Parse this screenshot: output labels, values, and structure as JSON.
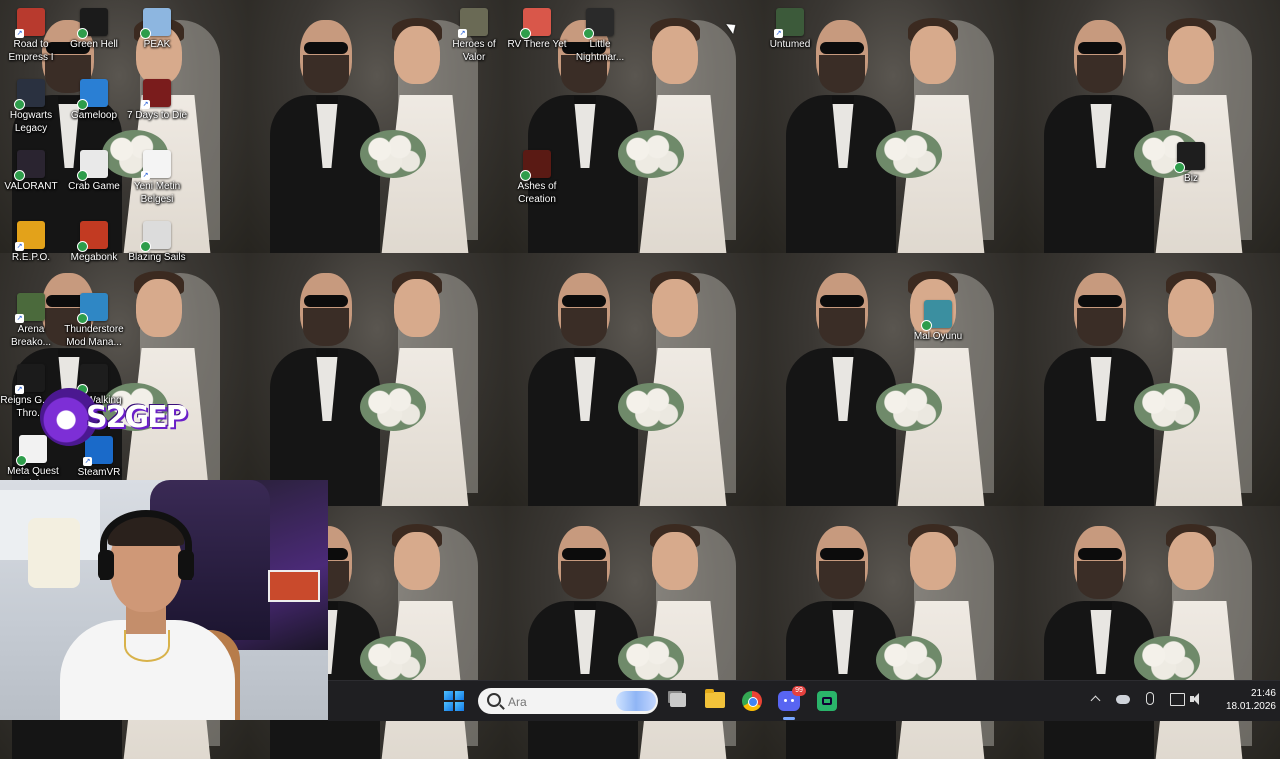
{
  "desktop": {
    "icons": [
      {
        "label": "Road to Empress I",
        "icon": "game-icon",
        "color": "#b83a2e"
      },
      {
        "label": "Green Hell",
        "icon": "game-icon",
        "color": "#1b1b1b"
      },
      {
        "label": "PEAK",
        "icon": "game-icon",
        "color": "#8db6e0"
      },
      {
        "label": "Heroes of Valor",
        "icon": "game-icon",
        "color": "#6a6a55"
      },
      {
        "label": "RV There Yet",
        "icon": "game-icon",
        "color": "#d9574a"
      },
      {
        "label": "Little Nightmar...",
        "icon": "game-icon",
        "color": "#2a2a2a"
      },
      {
        "label": "Untumed",
        "icon": "game-icon",
        "color": "#3c5a3a"
      },
      {
        "label": "Hogwarts Legacy",
        "icon": "game-icon",
        "color": "#2a3140"
      },
      {
        "label": "Gameloop",
        "icon": "game-icon",
        "color": "#2a7fd4"
      },
      {
        "label": "7 Days to Die",
        "icon": "game-icon",
        "color": "#7a1c1c"
      },
      {
        "label": "VALORANT",
        "icon": "valorant-icon",
        "color": "#2a2430"
      },
      {
        "label": "Crab Game",
        "icon": "game-icon",
        "color": "#e9e9e9"
      },
      {
        "label": "Yeni Metin Belgesi",
        "icon": "text-document-icon",
        "color": "#f4f4f4"
      },
      {
        "label": "Ashes of Creation",
        "icon": "game-icon",
        "color": "#5a1a14"
      },
      {
        "label": "Biz",
        "icon": "folder-icon",
        "color": "#1e1e1e"
      },
      {
        "label": "R.E.P.O.",
        "icon": "game-icon",
        "color": "#e3a21a"
      },
      {
        "label": "Megabonk",
        "icon": "game-icon",
        "color": "#c23a22"
      },
      {
        "label": "Blazing Sails",
        "icon": "skull-icon",
        "color": "#dcdcdc"
      },
      {
        "label": "Arena Breako...",
        "icon": "game-icon",
        "color": "#4b6a3c"
      },
      {
        "label": "Thunderstore Mod Mana...",
        "icon": "game-icon",
        "color": "#2f87c5"
      },
      {
        "label": "Mal Oyunu",
        "icon": "game-icon",
        "color": "#3b8fa0"
      },
      {
        "label": "Reigns G... of Thro...",
        "icon": "game-icon",
        "color": "#1b1b1b"
      },
      {
        "label": "The Walking",
        "icon": "game-icon",
        "color": "#1d1d1d"
      },
      {
        "label": "Meta Quest Link",
        "icon": "meta-icon",
        "color": "#f2f2f2"
      },
      {
        "label": "SteamVR",
        "icon": "steamvr-icon",
        "color": "#1a6ac9"
      }
    ]
  },
  "overlay": {
    "logo_text": "S2GEP"
  },
  "taskbar": {
    "search_placeholder": "Ara",
    "discord_badge": "99",
    "clock_time": "21:46",
    "clock_date": "18.01.2026",
    "accent": "#1479e6"
  }
}
